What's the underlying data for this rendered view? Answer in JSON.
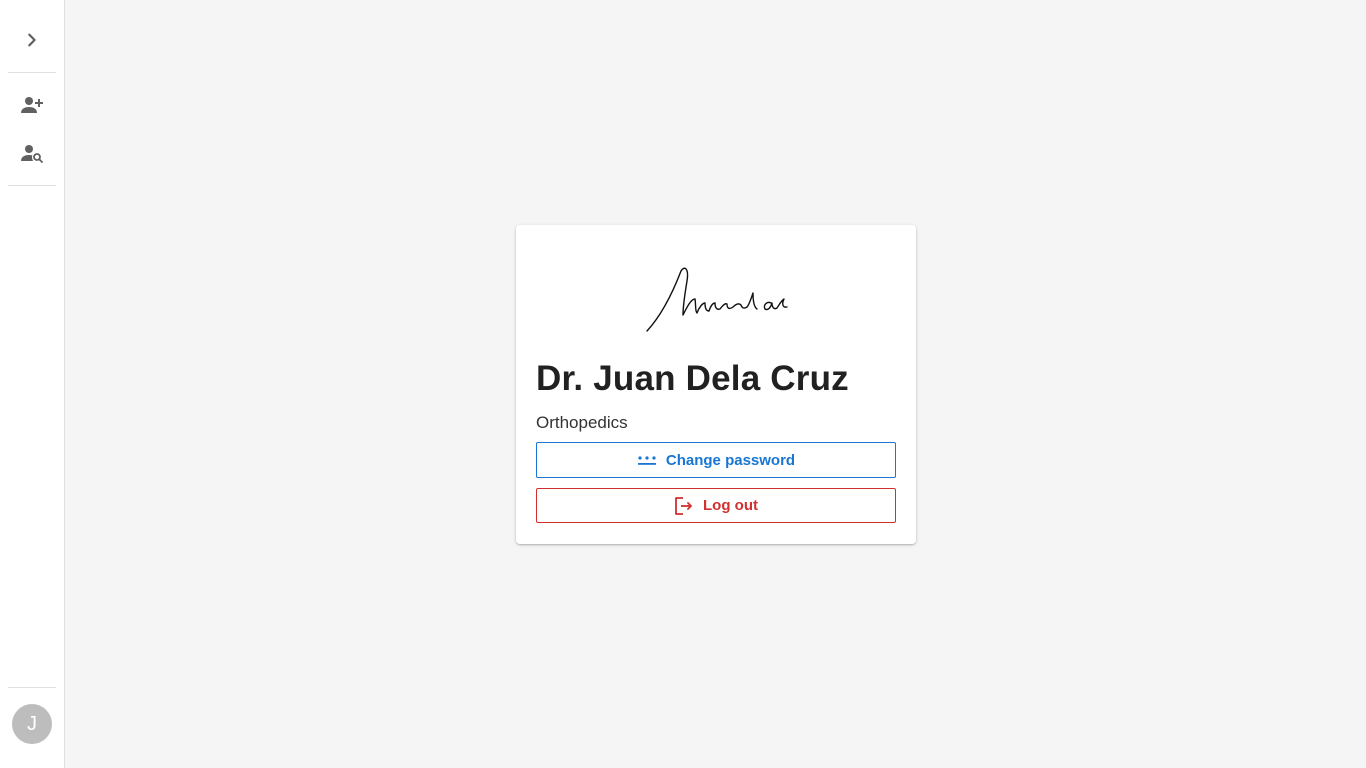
{
  "sidebar": {
    "expand_icon": "chevron-right-icon",
    "items": [
      {
        "name": "add-patient",
        "icon": "person-add-icon"
      },
      {
        "name": "search-patient",
        "icon": "person-search-icon"
      }
    ],
    "avatar_initial": "J"
  },
  "profile": {
    "signature_text": "Muhammad ali",
    "name": "Dr. Juan Dela Cruz",
    "specialty": "Orthopedics"
  },
  "actions": {
    "change_password_label": "Change password",
    "change_password_icon": "password-dots-icon",
    "logout_label": "Log out",
    "logout_icon": "logout-icon"
  },
  "colors": {
    "primary": "#1976d2",
    "danger": "#d32f2f",
    "avatar_bg": "#bdbdbd",
    "background": "#f5f5f5"
  }
}
